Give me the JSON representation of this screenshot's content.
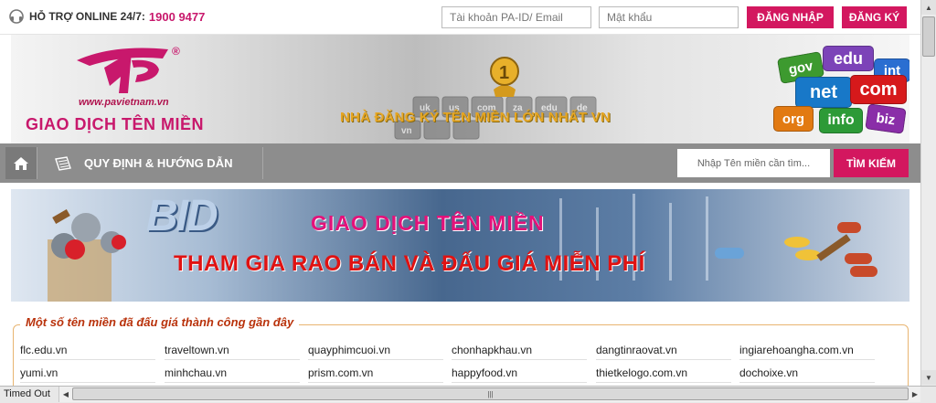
{
  "colors": {
    "accent": "#d3175f",
    "nav": "#8d8d8d",
    "legend": "#b9320b",
    "slogan": "#e6a623"
  },
  "topbar": {
    "support_label": "HỖ TRỢ ONLINE 24/7:",
    "support_phone": "1900 9477",
    "account_placeholder": "Tài khoản PA-ID/ Email",
    "password_placeholder": "Mật khẩu",
    "login_label": "ĐĂNG NHẬP",
    "register_label": "ĐĂNG KÝ"
  },
  "banner": {
    "logo_url": "www.pavietnam.vn",
    "title": "GIAO DỊCH TÊN MIỀN",
    "slogan": "NHÀ ĐĂNG KÝ TÊN MIỀN LỚN NHẤT VN",
    "logo_mark": "®",
    "tld_badges": [
      "edu",
      "gov",
      "int",
      "net",
      "com",
      "org",
      "info",
      "biz"
    ],
    "key_labels": [
      "uk",
      "us",
      "com",
      "za",
      "edu",
      "de",
      "vn"
    ]
  },
  "nav": {
    "home_icon": "home-icon",
    "guide_label": "QUY ĐỊNH & HƯỚNG DẪN",
    "search_placeholder": "Nhập Tên miền cần tìm...",
    "search_button": "TÌM KIẾM"
  },
  "promo": {
    "bid_word": "BID",
    "line1": "GIAO DỊCH TÊN MIỀN",
    "line2": "THAM GIA RAO BÁN VÀ ĐẤU GIÁ MIỄN PHÍ"
  },
  "auction": {
    "legend": "Một số tên miền đã đấu giá thành công gần đây",
    "rows": [
      [
        "flc.edu.vn",
        "traveltown.vn",
        "quayphimcuoi.vn",
        "chonhapkhau.vn",
        "dangtinraovat.vn",
        "ingiarehoangha.com.vn"
      ],
      [
        "yumi.vn",
        "minhchau.vn",
        "prism.com.vn",
        "happyfood.vn",
        "thietkelogo.com.vn",
        "dochoixe.vn"
      ]
    ]
  },
  "status": {
    "text": "Timed Out"
  }
}
